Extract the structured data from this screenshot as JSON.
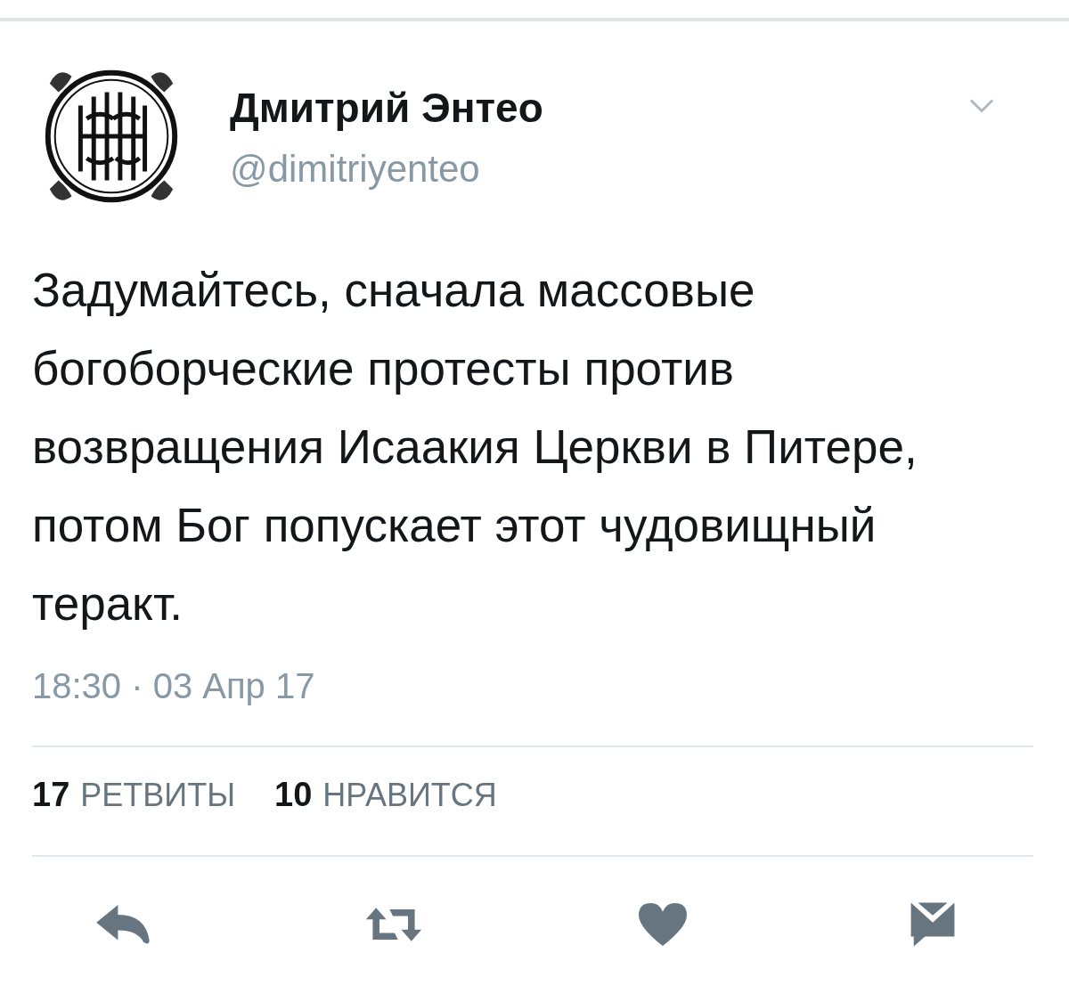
{
  "tweet": {
    "author_name": "Дмитрий Энтео",
    "handle": "@dimitriyenteo",
    "text": "Задумайтесь, сначала массовые богоборческие протесты против возвращения Исаакия Церкви в Питере, потом Бог попускает этот чудовищный теракт.",
    "timestamp": "18:30 · 03 Апр 17",
    "stats": [
      {
        "count": "17",
        "label": "РЕТВИТЫ"
      },
      {
        "count": "10",
        "label": "НРАВИТСЯ"
      }
    ]
  }
}
